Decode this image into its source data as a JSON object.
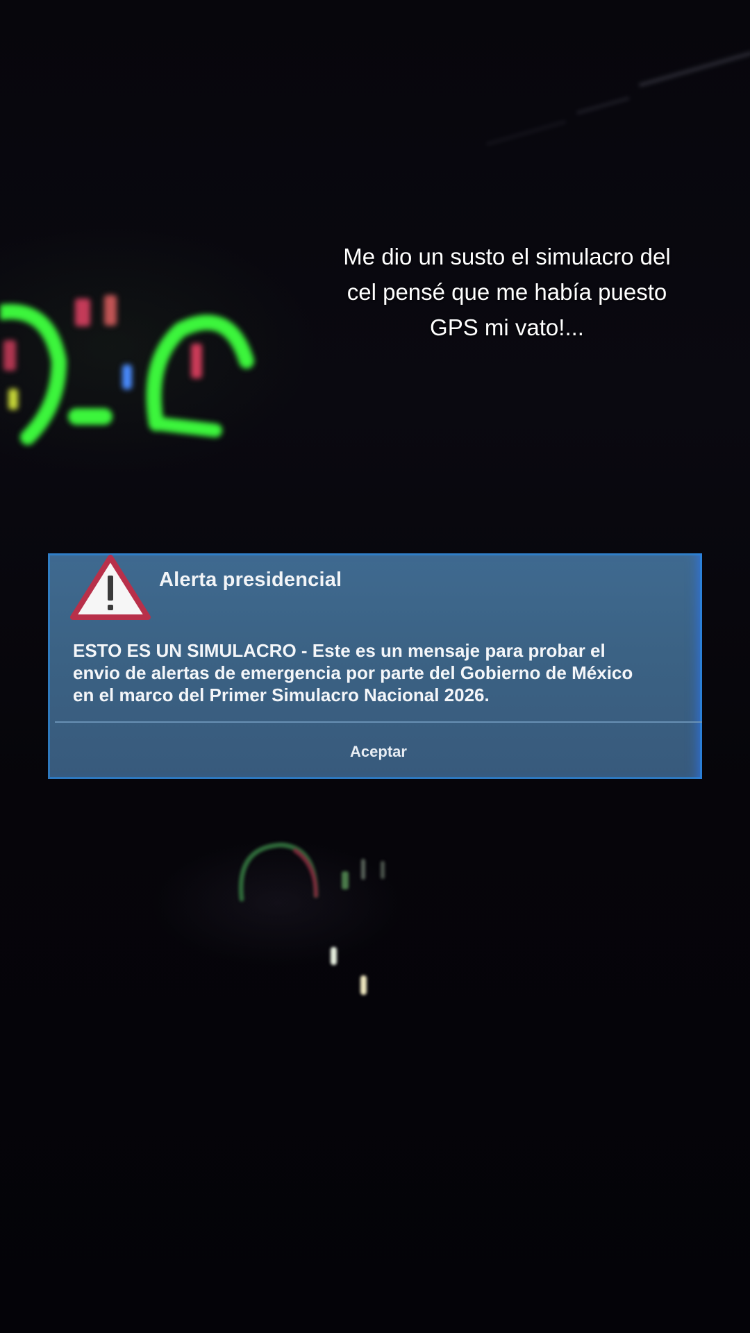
{
  "caption": {
    "line1": "Me dio un susto el simulacro del",
    "line2": "cel pensé que me había puesto",
    "line3": "GPS mi vato!..."
  },
  "alert": {
    "title": "Alerta presidencial",
    "body_line1": "ESTO ES UN SIMULACRO - Este es un mensaje para probar el",
    "body_line2": "envio de alertas de emergencia por parte del Gobierno de México",
    "body_line3": "en el marco del Primer Simulacro Nacional 2026.",
    "accept_label": "Aceptar",
    "icon": "warning-triangle-icon"
  },
  "colors": {
    "dialog_bg": "#3b6284",
    "dialog_edge": "#2a8ef0",
    "warning_red": "#b8304a",
    "dashboard_green": "#3cff3c",
    "dashboard_red": "#e0405a",
    "dashboard_blue": "#4a90ff",
    "caption_text": "#ffffff"
  }
}
